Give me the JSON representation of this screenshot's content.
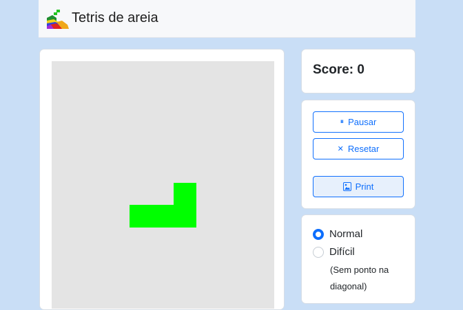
{
  "header": {
    "title": "Tetris de areia"
  },
  "board": {
    "piece_color": "#00ff00",
    "background": "#e4e4e4"
  },
  "score": {
    "label": "Score: 0"
  },
  "controls": {
    "pause_label": "Pausar",
    "reset_label": "Resetar",
    "print_label": "Print"
  },
  "mode": {
    "options": [
      {
        "label": "Normal",
        "selected": true
      },
      {
        "label": "Difícil",
        "selected": false
      }
    ],
    "note_line1": "(Sem ponto na",
    "note_line2": "diagonal)"
  },
  "colors": {
    "accent": "#0d6efd",
    "page_background": "#c9def6"
  }
}
